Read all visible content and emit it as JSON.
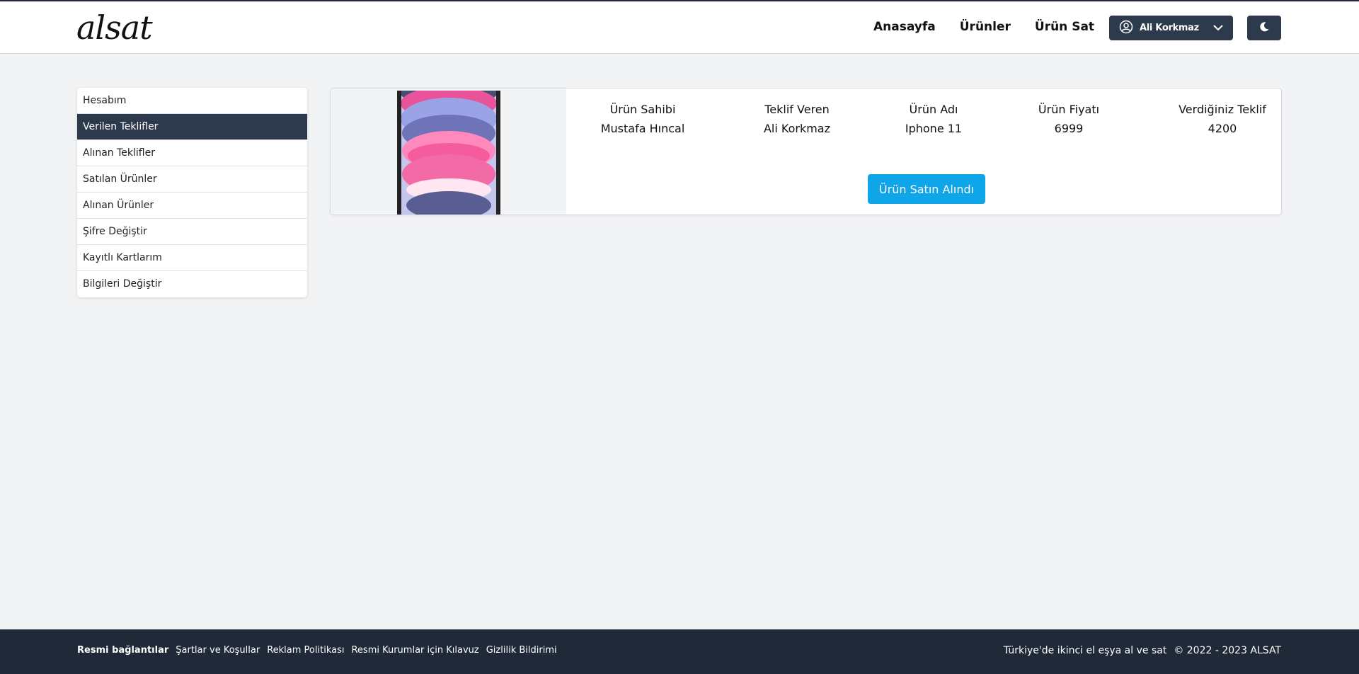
{
  "header": {
    "logo": "alsat",
    "nav": [
      "Anasayfa",
      "Ürünler",
      "Ürün Sat"
    ],
    "user_name": "Ali Korkmaz"
  },
  "sidebar": {
    "items": [
      {
        "label": "Hesabım",
        "active": false
      },
      {
        "label": "Verilen Teklifler",
        "active": true
      },
      {
        "label": "Alınan Teklifler",
        "active": false
      },
      {
        "label": "Satılan Ürünler",
        "active": false
      },
      {
        "label": "Alınan Ürünler",
        "active": false
      },
      {
        "label": "Şifre Değiştir",
        "active": false
      },
      {
        "label": "Kayıtlı Kartlarım",
        "active": false
      },
      {
        "label": "Bilgileri Değiştir",
        "active": false
      }
    ]
  },
  "offer": {
    "headers": [
      "Ürün Sahibi",
      "Teklif Veren",
      "Ürün Adı",
      "Ürün Fiyatı",
      "Verdiğiniz Teklif"
    ],
    "values": [
      "Mustafa Hıncal",
      "Ali Korkmaz",
      "Iphone 11",
      "6999",
      "4200"
    ],
    "button_label": "Ürün Satın Alındı"
  },
  "footer": {
    "title": "Resmi bağlantılar",
    "links": [
      "Şartlar ve Koşullar",
      "Reklam Politikası",
      "Resmi Kurumlar için Kılavuz",
      "Gizlilik Bildirimi"
    ],
    "tagline": "Türkiye'de ikinci el eşya al ve sat",
    "copyright": "© 2022 - 2023 ALSAT"
  },
  "colors": {
    "navy": "#2d3a4d",
    "accent": "#0ea5e9",
    "footer_bg": "#1f2937"
  }
}
